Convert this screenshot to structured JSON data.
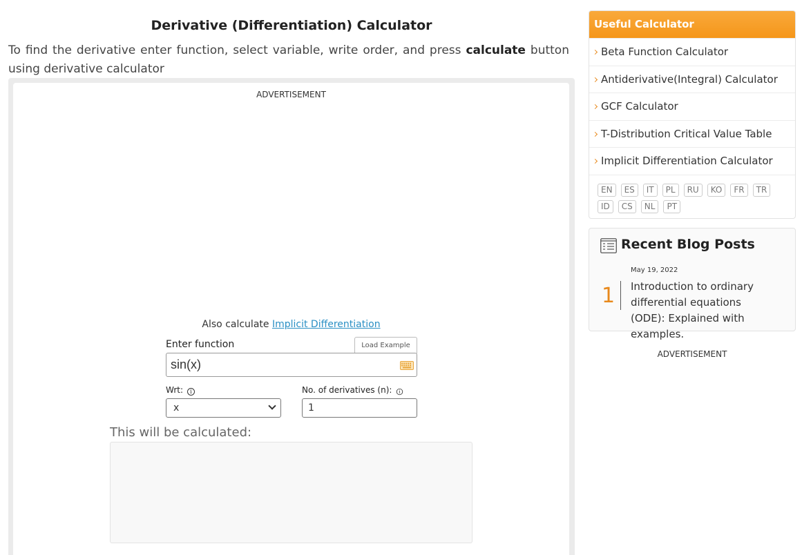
{
  "page": {
    "title": "Derivative (Differentiation) Calculator",
    "intro_before": "To find the derivative enter function, select variable, write order, and press ",
    "intro_bold": "calculate",
    "intro_after": " button using derivative calculator"
  },
  "calculator": {
    "ad_label": "ADVERTISEMENT",
    "also_text": "Also calculate ",
    "also_link": "Implicit Differentiation",
    "function_label": "Enter function",
    "load_example": "Load Example",
    "function_value": "sin(x)",
    "wrt_label": "Wrt:",
    "wrt_value": "x",
    "n_label": "No. of derivatives (n):",
    "n_value": "1",
    "info_glyph": "i",
    "preview_label": "This will be calculated:"
  },
  "sidebar": {
    "useful_title": "Useful Calculator",
    "items": [
      {
        "label": "Beta Function Calculator"
      },
      {
        "label": "Antiderivative(Integral) Calculator"
      },
      {
        "label": "GCF Calculator"
      },
      {
        "label": "T-Distribution Critical Value Table"
      },
      {
        "label": "Implicit Differentiation Calculator"
      }
    ],
    "languages": [
      "EN",
      "ES",
      "IT",
      "PL",
      "RU",
      "KO",
      "FR",
      "TR",
      "ID",
      "CS",
      "NL",
      "PT"
    ],
    "blog_title": "Recent Blog Posts",
    "posts": [
      {
        "number": "1",
        "date": "May 19, 2022",
        "title": "Introduction to ordinary differential equations (ODE): Explained with examples."
      }
    ],
    "ad_label": "ADVERTISEMENT"
  },
  "colors": {
    "accent": "#f5961a",
    "link": "#2a8fc4"
  }
}
